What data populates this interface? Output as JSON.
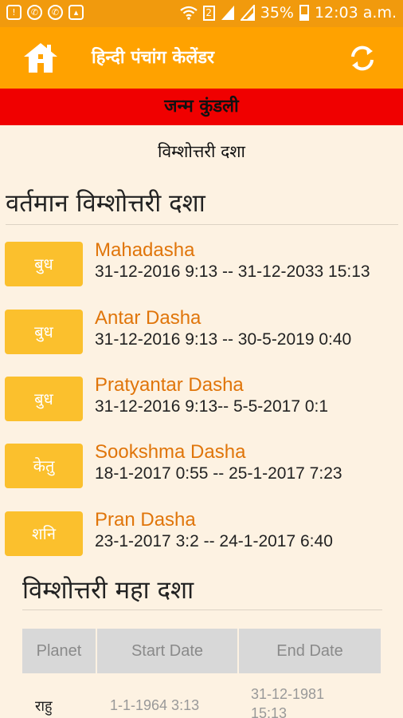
{
  "status_bar": {
    "time": "12:03 a.m.",
    "battery": "35%",
    "sim_slot": "2",
    "left_icons": [
      "notification-icon",
      "whatsapp-icon",
      "whatsapp-icon",
      "image-icon"
    ],
    "right_icons": [
      "wifi-icon",
      "sim-icon",
      "signal-icon",
      "signal-icon",
      "battery-icon"
    ]
  },
  "app_bar": {
    "title": "हिन्दी पंचांग केलेंडर",
    "left_icon": "home-icon",
    "right_icon": "refresh-icon",
    "color": "#ffa200"
  },
  "banner": {
    "text": "जन्म कुंडली",
    "color": "#f00000"
  },
  "subtitle": "विम्शोत्तरी दशा",
  "current_section": {
    "heading": "वर्तमान विम्शोत्तरी दशा",
    "items": [
      {
        "planet": "बुध",
        "name": "Mahadasha",
        "range": "31-12-2016 9:13 -- 31-12-2033 15:13"
      },
      {
        "planet": "बुध",
        "name": "Antar Dasha",
        "range": "31-12-2016 9:13 -- 30-5-2019 0:40"
      },
      {
        "planet": "बुध",
        "name": "Pratyantar Dasha",
        "range": "31-12-2016 9:13-- 5-5-2017 0:1"
      },
      {
        "planet": "केतु",
        "name": "Sookshma Dasha",
        "range": "18-1-2017 0:55 -- 25-1-2017 7:23"
      },
      {
        "planet": "शनि",
        "name": "Pran Dasha",
        "range": "23-1-2017 3:2 -- 24-1-2017 6:40"
      }
    ]
  },
  "maha_section": {
    "heading": "विम्शोत्तरी महा दशा",
    "columns": [
      "Planet",
      "Start Date",
      "End Date"
    ],
    "rows": [
      {
        "planet": "राहु",
        "start": "1-1-1964 3:13",
        "end_line1": "31-12-1981",
        "end_line2": "15:13"
      }
    ]
  }
}
